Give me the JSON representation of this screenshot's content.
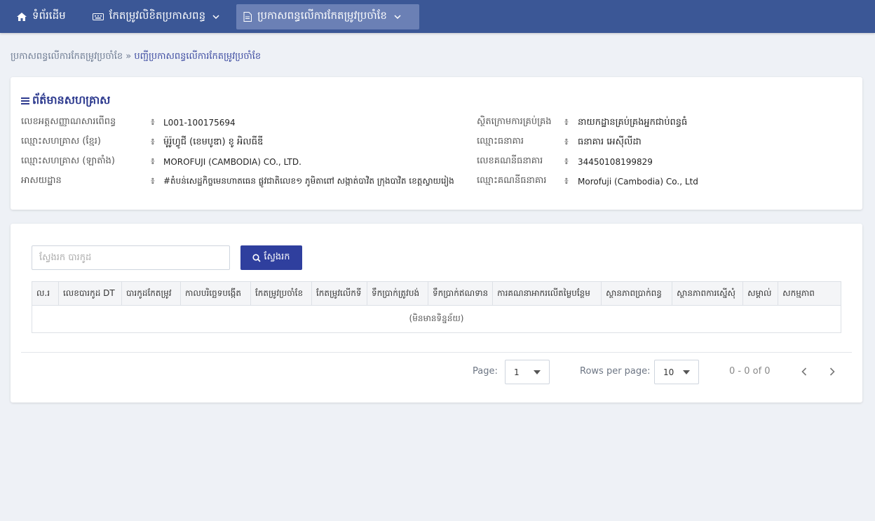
{
  "nav": {
    "home": "ទំព័រដើម",
    "edit_declaration": "កែតម្រូវលិខិតប្រកាសពន្ធ",
    "monthly_correction": "ប្រកាសពន្ធលើការកែតម្រូវប្រចាំខែ"
  },
  "breadcrumb": {
    "parent": "ប្រកាសពន្ធលើការកែតម្រូវប្រចាំខែ",
    "separator": "»",
    "current": "បញ្ជីប្រកាសពន្ធលើការកែតម្រូវប្រចាំខែ"
  },
  "info": {
    "title": "ព័ត៌មានសហគ្រាស",
    "separator": "៖",
    "left": [
      {
        "label": "លេខអត្តសញ្ញាណសារពើពន្ធ",
        "value": "L001-100175694"
      },
      {
        "label": "ឈ្មោះសហគ្រាស (ខ្មែរ)",
        "value": "ម៉ូរ៉ូហ្វូជី (ខេមបូឌា) ខូ អិលធីឌី"
      },
      {
        "label": "ឈ្មោះសហគ្រាស (ឡាតាំង)",
        "value": "MOROFUJI (CAMBODIA) CO., LTD."
      },
      {
        "label": "អាសយដ្ឋាន",
        "value": "#តំបន់សេដ្ឋកិច្ចមេនហាតធេន ផ្លូវជាតិលេខ១ ភូមិតាពៅ សង្កាត់បាវិត ក្រុងបាវិត ខេត្តស្វាយរៀង"
      }
    ],
    "right": [
      {
        "label": "ស្ថិតក្រោមការគ្រប់គ្រង",
        "value": "នាយកដ្ឋានគ្រប់គ្រងអ្នកជាប់ពន្ធធំ"
      },
      {
        "label": "ឈ្មោះធនាគារ",
        "value": "ធនាគារ អេស៊ីលីដា"
      },
      {
        "label": "លេខគណនីធនាគារ",
        "value": "34450108199829"
      },
      {
        "label": "ឈ្មោះគណនីធនាគារ",
        "value": "Morofuji (Cambodia) Co., Ltd"
      }
    ]
  },
  "search": {
    "placeholder": "ស្វែងរក បារកូដ",
    "button": "ស្វែងរក"
  },
  "table": {
    "columns": [
      "ល.រ",
      "លេខបារកូដ DT",
      "បារកូដកែតម្រូវ",
      "កាលបរិច្ឆេទបង្កើត",
      "កែតម្រូវប្រចាំខែ",
      "កែតម្រូវលើកទី",
      "ទឹកប្រាក់ត្រូវបង់",
      "ទឹកប្រាក់ឥណទាន",
      "ការគណនាអាករលើតម្លៃបន្ថែម",
      "ស្ថានភាពប្រាក់ពន្ធ",
      "ស្ថានភាពការស្នើសុំ",
      "សម្គាល់",
      "សកម្មភាព"
    ],
    "empty": "(មិនមានទិន្នន័យ)"
  },
  "pager": {
    "page_label": "Page:",
    "page_value": "1",
    "rows_label": "Rows per page:",
    "rows_value": "10",
    "range": "0 - 0 of 0"
  },
  "colors": {
    "nav_bg": "#3b5796",
    "nav_active": "#6b80b5",
    "accent": "#2f3f9e"
  }
}
